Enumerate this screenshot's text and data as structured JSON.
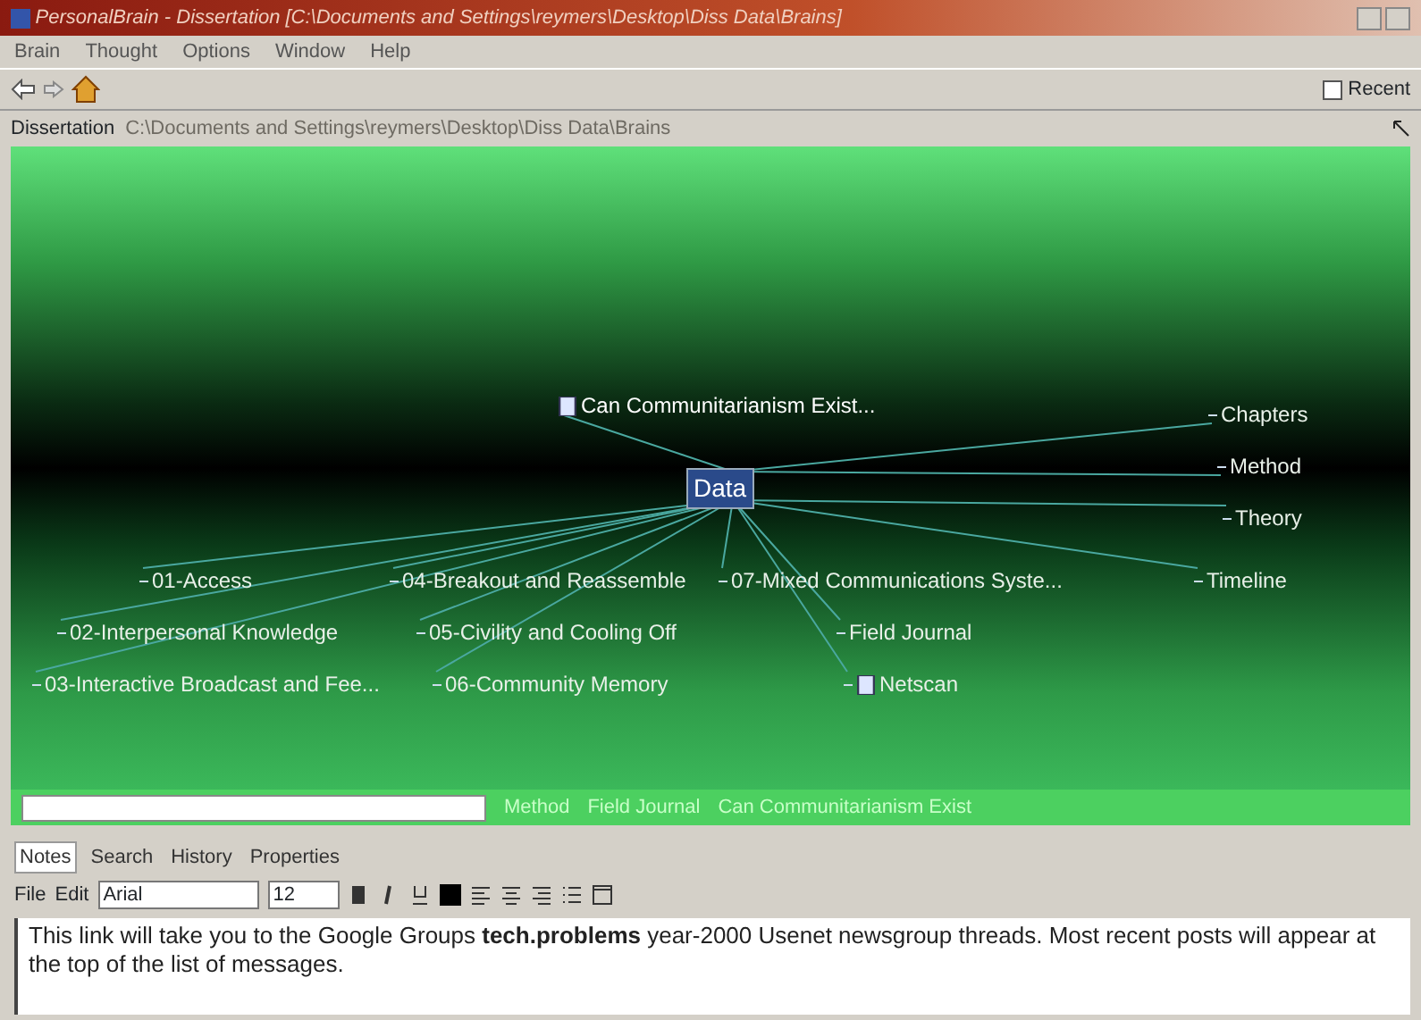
{
  "window": {
    "title": "PersonalBrain - Dissertation [C:\\Documents and Settings\\reymers\\Desktop\\Diss Data\\Brains]"
  },
  "menu": [
    "Brain",
    "Thought",
    "Options",
    "Window",
    "Help"
  ],
  "toolbar": {
    "recent": {
      "label": "Recent",
      "checked": false
    }
  },
  "path_bar": {
    "brain": "Dissertation",
    "path": "C:\\Documents and Settings\\reymers\\Desktop\\Diss Data\\Brains"
  },
  "plex": {
    "active": {
      "label": "Data"
    },
    "nodes": [
      {
        "label": "Can Communitarianism Exist...",
        "kind": "parent",
        "icon": true
      },
      {
        "label": "Chapters",
        "kind": "jump",
        "icon": false
      },
      {
        "label": "Method",
        "kind": "jump",
        "icon": false
      },
      {
        "label": "Theory",
        "kind": "jump",
        "icon": false
      },
      {
        "label": "01-Access",
        "kind": "child",
        "icon": false
      },
      {
        "label": "04-Breakout and Reassemble",
        "kind": "child",
        "icon": false
      },
      {
        "label": "07-Mixed Communications Syste...",
        "kind": "child",
        "icon": false
      },
      {
        "label": "Timeline",
        "kind": "jump",
        "icon": false
      },
      {
        "label": "02-Interpersonal Knowledge",
        "kind": "child",
        "icon": false
      },
      {
        "label": "05-Civility and Cooling Off",
        "kind": "child",
        "icon": false
      },
      {
        "label": "Field Journal",
        "kind": "child",
        "icon": false
      },
      {
        "label": "03-Interactive Broadcast and Fee...",
        "kind": "child",
        "icon": false
      },
      {
        "label": "06-Community Memory",
        "kind": "child",
        "icon": false
      },
      {
        "label": "Netscan",
        "kind": "child",
        "icon": true
      }
    ]
  },
  "pins": [
    {
      "label": "Method"
    },
    {
      "label": "Field Journal"
    },
    {
      "label": "Can Communitarianism Exist"
    }
  ],
  "notes_tabs": [
    {
      "label": "Notes",
      "selected": true
    },
    {
      "label": "Search",
      "selected": false
    },
    {
      "label": "History",
      "selected": false
    },
    {
      "label": "Properties",
      "selected": false
    }
  ],
  "format_bar": {
    "file": "File",
    "edit": "Edit",
    "font": "Arial",
    "size": "12"
  },
  "notes": {
    "text": "This link will take you to the Google Groups **tech.problems** year-2000 Usenet newsgroup threads.  Most recent posts will appear at the top of the list of messages."
  }
}
